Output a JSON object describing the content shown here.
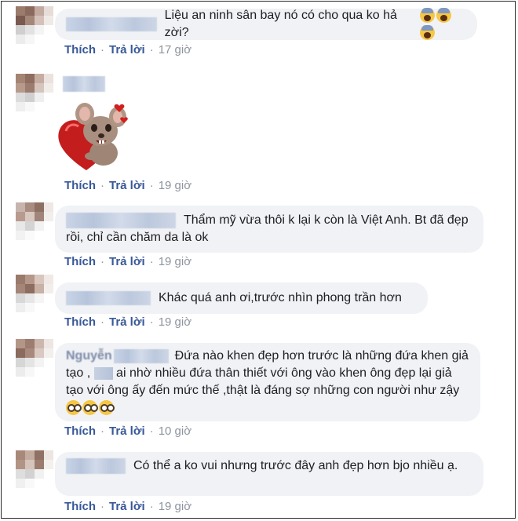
{
  "actions": {
    "like": "Thích",
    "reply": "Trả lời",
    "separator": "·"
  },
  "comments": [
    {
      "text": "Liệu an ninh sân bay nó có cho qua ko hả zời?",
      "time": "17 giờ"
    },
    {
      "sticker": "heart-mouse-sticker",
      "time": "19 giờ"
    },
    {
      "text": "Thẩm mỹ vừa thôi k lại k còn là Việt Anh. Bt đã đẹp rồi, chỉ cần chăm da là ok",
      "time": "19 giờ"
    },
    {
      "text": "Khác quá anh ơi,trước nhìn phong trần hơn",
      "time": "19 giờ"
    },
    {
      "name_partial": "Nguyễn",
      "text_a": "Đứa nào khen đẹp hơn trước là những đứa khen giả tạo ,",
      "text_b": "ai nhờ nhiều đứa thân thiết với ông vào khen ông đẹp lại giả tạo với ông ấy đến mức thế ,thật là đáng sợ những con người như zậy",
      "time": "10 giờ"
    },
    {
      "text": "Có thể a ko vui nhưng trước đây anh đẹp hơn bjo nhiều ạ.",
      "time": "19 giờ"
    }
  ],
  "colors": {
    "link": "#385898",
    "meta": "#8d949e",
    "bubble": "#f0f2f5",
    "text": "#1c1e21"
  }
}
